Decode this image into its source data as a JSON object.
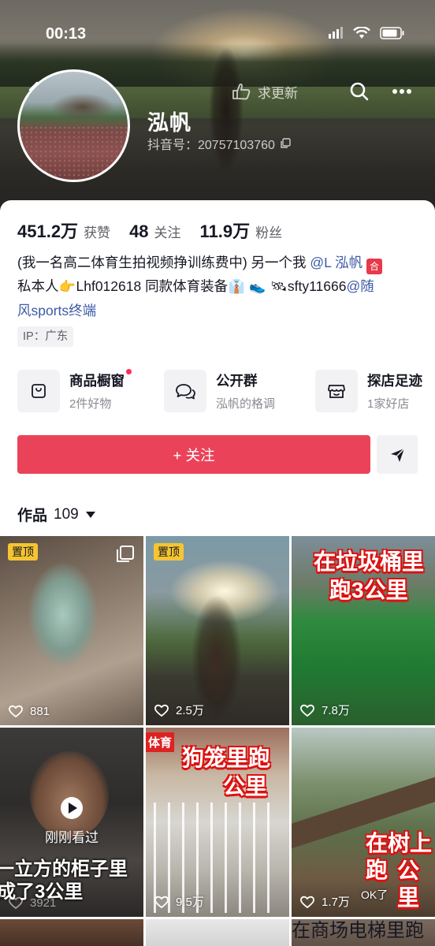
{
  "status_bar": {
    "time": "00:13"
  },
  "header": {
    "update_label": "求更新",
    "username": "泓帆",
    "douyin_id": "抖音号：20757103760"
  },
  "stats": [
    {
      "num": "451.2万",
      "label": "获赞"
    },
    {
      "num": "48",
      "label": "关注"
    },
    {
      "num": "11.9万",
      "label": "粉丝"
    }
  ],
  "bio": {
    "line1_text": "(我一名高二体育生拍视频挣训练费中) 另一个我 ",
    "line1_mention": "@L 泓帆",
    "line1_tag": "合",
    "line2_a": "私本人",
    "line2_emoji1": "👉",
    "line2_b": "Lhf012618 同款体育装备",
    "line2_emoji2": "👔",
    "line2_emoji3": "👟",
    "line2_emoji4": "🛰",
    "line2_c": "sfty11666",
    "line2_mention": "@随",
    "line3_mention": "风sports终端"
  },
  "ip": "IP：广东",
  "shortcuts": [
    {
      "title": "商品橱窗",
      "sub": "2件好物",
      "icon": "shopping-bag-icon"
    },
    {
      "title": "公开群",
      "sub": "泓帆的格调",
      "icon": "chat-bubbles-icon"
    },
    {
      "title": "探店足迹",
      "sub": "1家好店",
      "icon": "store-icon"
    }
  ],
  "follow_label": "+ 关注",
  "works": {
    "label": "作品",
    "count": "109"
  },
  "videos": [
    {
      "likes": "881",
      "pinned": "置顶"
    },
    {
      "likes": "2.5万",
      "pinned": "置顶"
    },
    {
      "likes": "7.8万",
      "caption_1": "在垃圾桶里",
      "caption_2": "跑3公里"
    },
    {
      "likes": "3921",
      "watched": "刚刚看过",
      "caption_1": "一立方的柜子里",
      "caption_2": "成了3公里"
    },
    {
      "likes": "9.5万",
      "caption_1": "狗笼里跑",
      "caption_2": "公里",
      "sign": "体育"
    },
    {
      "likes": "1.7万",
      "caption_1": "在树上跑",
      "caption_2": "公里",
      "note": "OK了"
    }
  ],
  "row3_caption": "在商场电梯里跑",
  "colors": {
    "accent": "#ea4359",
    "mention": "#3d5aa6",
    "pin": "#f5c531"
  }
}
